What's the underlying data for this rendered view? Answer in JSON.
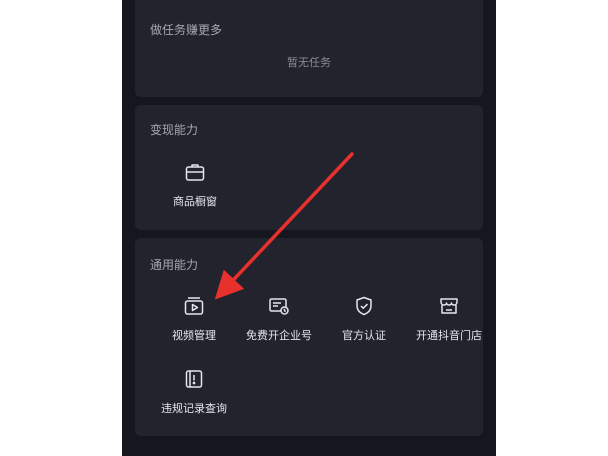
{
  "tasks_card": {
    "title": "做任务赚更多",
    "empty_text": "暂无任务"
  },
  "monetize_card": {
    "title": "变现能力",
    "items": [
      {
        "label": "商品橱窗",
        "icon": "shop-window-icon"
      }
    ]
  },
  "general_card": {
    "title": "通用能力",
    "items": [
      {
        "label": "视频管理",
        "icon": "video-manage-icon"
      },
      {
        "label": "免费开企业号",
        "icon": "enterprise-account-icon"
      },
      {
        "label": "官方认证",
        "icon": "verified-shield-icon"
      },
      {
        "label": "开通抖音门店",
        "icon": "store-icon"
      },
      {
        "label": "违规记录查询",
        "icon": "violation-record-icon"
      }
    ]
  },
  "colors": {
    "background": "#16161e",
    "card": "#22232d",
    "arrow": "#e8312c"
  }
}
